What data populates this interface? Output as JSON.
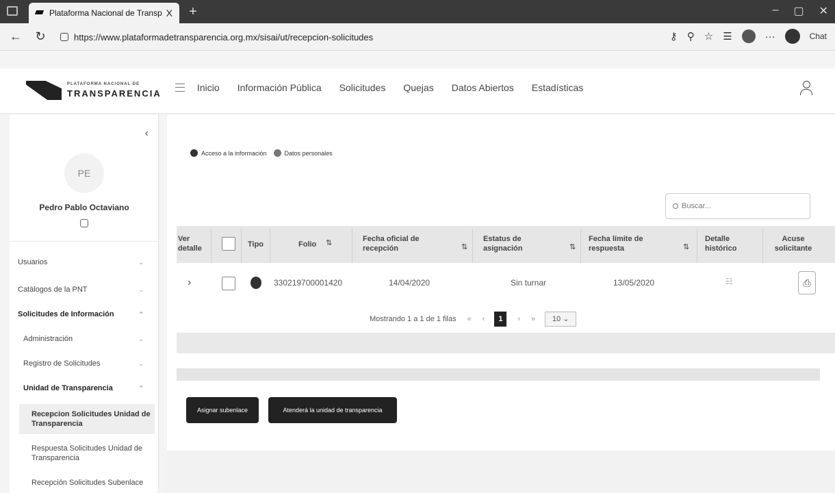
{
  "browser": {
    "tab_title": "Plataforma Nacional de Transpar",
    "tab_close": "X",
    "url": "https://www.plataformadetransparencia.org.mx/sisai/ut/recepcion-solicitudes",
    "chat_label": "Chat"
  },
  "header": {
    "logo_subtitle": "PLATAFORMA NACIONAL DE",
    "logo_title": "TRANSPARENCIA",
    "menu": [
      "Inicio",
      "Información Pública",
      "Solicitudes",
      "Quejas",
      "Datos Abiertos",
      "Estadísticas"
    ]
  },
  "sidebar": {
    "avatar_initials": "PE",
    "user_name": "Pedro Pablo Octaviano",
    "items": [
      {
        "label": "Usuarios"
      },
      {
        "label": "Catálogos de la PNT"
      },
      {
        "label": "Solicitudes de Información"
      },
      {
        "label": "Administración"
      },
      {
        "label": "Registro de Solicitudes"
      },
      {
        "label": "Unidad de Transparencia"
      },
      {
        "label": "Recepcion Solicitudes Unidad de Transparencia"
      },
      {
        "label": "Respuesta Solicitudes Unidad de Transparencia"
      },
      {
        "label": "Recepción Solicitudes Subenlace"
      }
    ]
  },
  "main": {
    "legend": {
      "access": "Acceso a la información",
      "personal": "Datos personales"
    },
    "search_placeholder": "Buscar...",
    "columns": [
      "Ver detalle",
      "Tipo",
      "Folio",
      "Fecha oficial de recepción",
      "Estatus de asignación",
      "Fecha límite de respuesta",
      "Detalle histórico",
      "Acuse solicitante"
    ],
    "rows": [
      {
        "folio": "330219700001420",
        "fecha_recepcion": "14/04/2020",
        "estatus": "Sin turnar",
        "fecha_limite": "13/05/2020"
      }
    ],
    "pager": {
      "info": "Mostrando 1 a 1 de 1 filas",
      "current_page": "1",
      "page_size": "10"
    },
    "buttons": {
      "assign": "Asignar subenlace",
      "attend": "Atenderá la unidad de transparencia"
    }
  }
}
